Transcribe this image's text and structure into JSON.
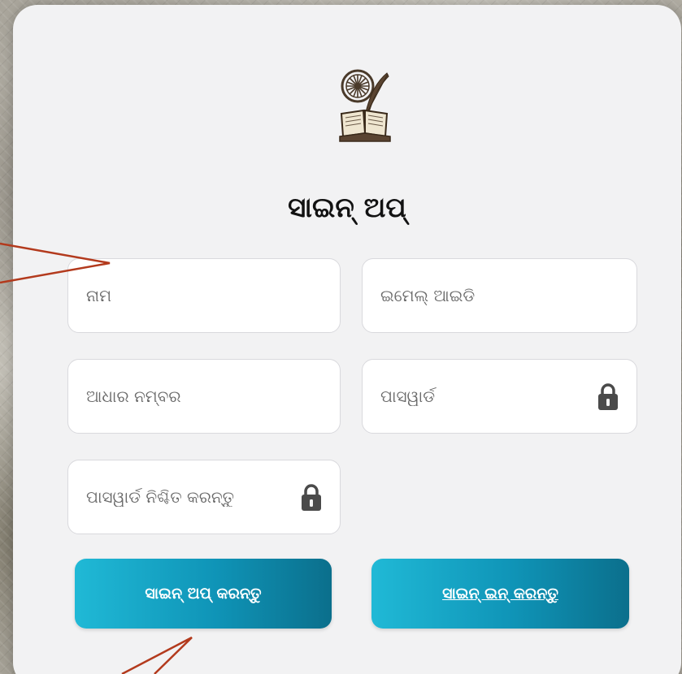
{
  "signup": {
    "title": "ସାଇନ୍ ଅପ୍",
    "fields": {
      "name": {
        "placeholder": "ନାମ"
      },
      "email": {
        "placeholder": "ଇମେଲ୍ ଆଇଡି"
      },
      "aadhaar": {
        "placeholder": "ଆଧାର ନମ୍ବର"
      },
      "password": {
        "placeholder": "ପାସୱାର୍ଡ",
        "icon": "lock-icon"
      },
      "confirm_password": {
        "placeholder": "ପାସୱାର୍ଡ ନିଶ୍ଚିତ କରନ୍ତୁ",
        "icon": "lock-icon"
      }
    },
    "buttons": {
      "signup": "ସାଇନ୍ ଅପ୍ କରନ୍ତୁ",
      "signin": "ସାଇନ୍ ଇନ୍ କରନ୍ତୁ"
    }
  },
  "logo": {
    "icon": "book-wheel-quill-icon"
  },
  "annotation": {
    "color": "#b33a1d"
  },
  "colors": {
    "button_start": "#20b9d6",
    "button_end": "#0b6f8c",
    "card_bg": "#f2f2f3"
  }
}
